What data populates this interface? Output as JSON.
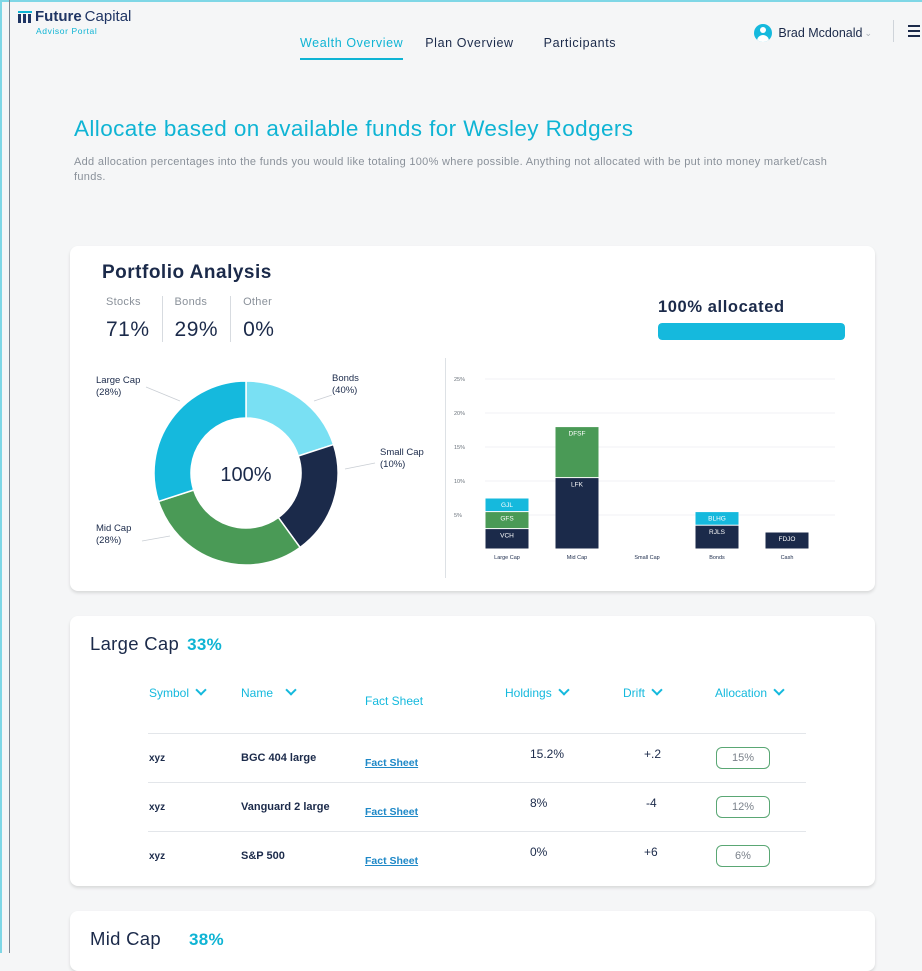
{
  "header": {
    "logo_bold": "Future",
    "logo_rest": "Capital",
    "logo_sub": "Advisor Portal",
    "nav": [
      "Wealth Overview",
      "Plan Overview",
      "Participants"
    ],
    "active_nav": "Wealth Overview",
    "user_name": "Brad Mcdonald"
  },
  "page": {
    "title": "Allocate based on available funds for Wesley Rodgers",
    "subtitle": "Add allocation percentages into the funds you would like totaling 100% where possible. Anything not allocated with be put into money market/cash funds."
  },
  "portfolio": {
    "title": "Portfolio Analysis",
    "mix": [
      {
        "label": "Stocks",
        "value": "71%"
      },
      {
        "label": "Bonds",
        "value": "29%"
      },
      {
        "label": "Other",
        "value": "0%"
      }
    ],
    "allocated_label": "100% allocated",
    "allocated_fraction": 1.0
  },
  "chart_data": [
    {
      "type": "pie",
      "center_label": "100%",
      "slices": [
        {
          "label": "Bonds",
          "value_label": "(40%)",
          "color": "#79e0f3"
        },
        {
          "label": "Small Cap",
          "value_label": "(10%)",
          "color": "#1b2a4a"
        },
        {
          "label": "Mid Cap",
          "value_label": "(28%)",
          "color": "#4a9a56"
        },
        {
          "label": "Large Cap",
          "value_label": "(28%)",
          "color": "#15b9dd"
        }
      ],
      "slice_sizes": [
        20,
        20,
        30,
        30
      ]
    },
    {
      "type": "bar",
      "stacked": true,
      "categories": [
        "Large Cap",
        "Mid Cap",
        "Small Cap",
        "Bonds",
        "Cash"
      ],
      "y_ticks": [
        "25%",
        "20%",
        "15%",
        "10%",
        "5%"
      ],
      "ylim": [
        0,
        25
      ],
      "grid": true,
      "stacks": [
        [
          {
            "name": "VCH",
            "value": 3,
            "color": "#1b2a4a"
          },
          {
            "name": "GFS",
            "value": 2.5,
            "color": "#4a9a56"
          },
          {
            "name": "GJL",
            "value": 2,
            "color": "#15b9dd"
          }
        ],
        [
          {
            "name": "LFK",
            "value": 10.5,
            "color": "#1b2a4a"
          },
          {
            "name": "DFSF",
            "value": 7.5,
            "color": "#4a9a56"
          }
        ],
        [],
        [
          {
            "name": "RJLS",
            "value": 3.5,
            "color": "#1b2a4a"
          },
          {
            "name": "BLHG",
            "value": 2,
            "color": "#15b9dd"
          }
        ],
        [
          {
            "name": "FDJO",
            "value": 2.5,
            "color": "#1b2a4a"
          }
        ]
      ]
    }
  ],
  "large_cap": {
    "title": "Large Cap",
    "percent": "33%",
    "columns": [
      "Symbol",
      "Name",
      "Fact Sheet",
      "Holdings",
      "Drift",
      "Allocation"
    ],
    "rows": [
      {
        "symbol": "xyz",
        "name": "BGC 404 large",
        "fact": "Fact Sheet",
        "holdings": "15.2%",
        "drift": "+.2",
        "allocation": "15%"
      },
      {
        "symbol": "xyz",
        "name": "Vanguard 2 large",
        "fact": "Fact Sheet",
        "holdings": "8%",
        "drift": "-4",
        "allocation": "12%"
      },
      {
        "symbol": "xyz",
        "name": "S&P 500",
        "fact": "Fact Sheet",
        "holdings": "0%",
        "drift": "+6",
        "allocation": "6%"
      }
    ]
  },
  "mid_cap": {
    "title": "Mid Cap",
    "percent": "38%"
  }
}
